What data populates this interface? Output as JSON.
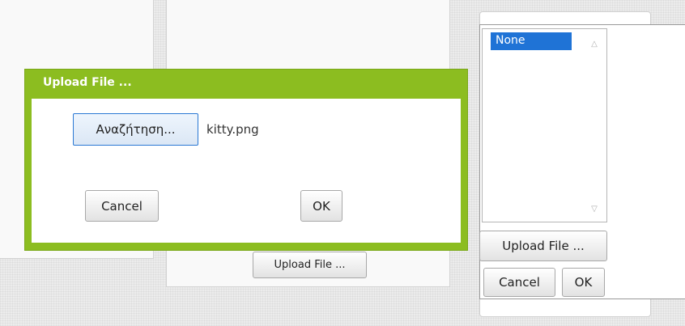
{
  "middle": {
    "upload_label": "Upload File ..."
  },
  "right": {
    "list_option": "None",
    "upload_label": "Upload File ...",
    "cancel_label": "Cancel",
    "ok_label": "OK"
  },
  "dialog": {
    "title": "Upload File ...",
    "browse_label": "Αναζήτηση...",
    "file_name": "kitty.png",
    "cancel_label": "Cancel",
    "ok_label": "OK"
  }
}
